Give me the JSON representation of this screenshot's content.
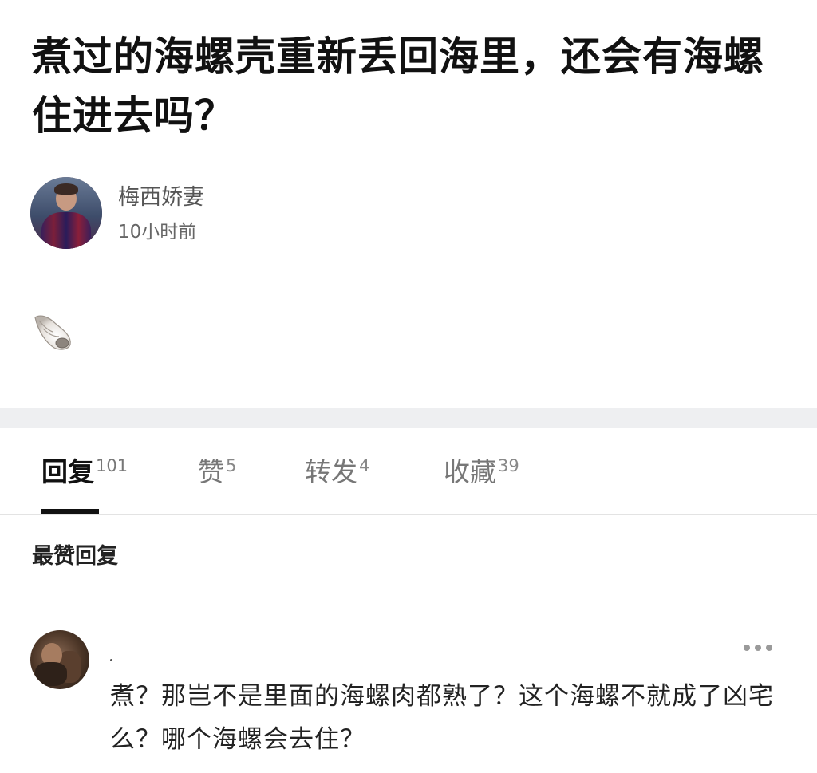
{
  "post": {
    "title": "煮过的海螺壳重新丢回海里，还会有海螺住进去吗？",
    "author_name": "梅西娇妻",
    "time": "10小时前",
    "body_emoji": "🐚"
  },
  "tabs": [
    {
      "label": "回复",
      "count": "101",
      "active": true
    },
    {
      "label": "赞",
      "count": "5",
      "active": false
    },
    {
      "label": "转发",
      "count": "4",
      "active": false
    },
    {
      "label": "收藏",
      "count": "39",
      "active": false
    }
  ],
  "replies_section": {
    "heading": "最赞回复"
  },
  "reply": {
    "text": "煮？那岂不是里面的海螺肉都熟了？这个海螺不就成了凶宅么？哪个海螺会去住？"
  },
  "colors": {
    "divider_band": "#eeeff1",
    "active_tab": "#111111",
    "inactive_tab": "#777777"
  }
}
